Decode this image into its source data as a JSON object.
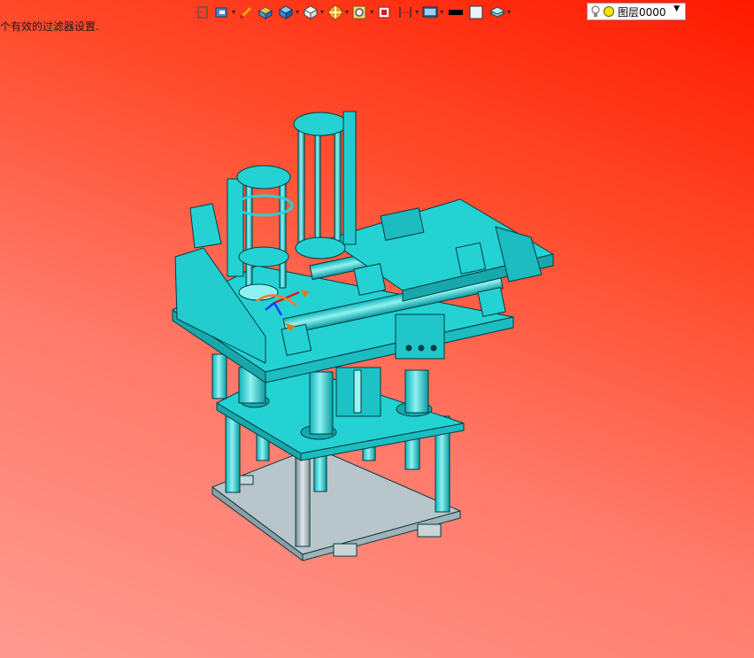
{
  "status": {
    "message": "个有效的过滤器设置."
  },
  "toolbar": {
    "items": [
      "exit-sketch-icon",
      "view-orientation-icon",
      "highlight-pen-icon",
      "shaded-display-icon",
      "solid-box-icon",
      "wireframe-box-icon",
      "section-view-icon",
      "zoom-icon",
      "fit-view-icon",
      "dimension-icon",
      "display-settings-icon",
      "color-black-icon",
      "color-light-icon",
      "layer-icon"
    ],
    "layer": {
      "name": "图层0000",
      "lightbulb": "lightbulb-icon",
      "status_color": "#f2e600"
    }
  },
  "colors": {
    "background_top": "#ff1a00",
    "background_bottom": "#ff9a90",
    "model_cyan": "#24d2d4",
    "model_outline": "#003c40",
    "base_plate": "#b8c6cc"
  }
}
